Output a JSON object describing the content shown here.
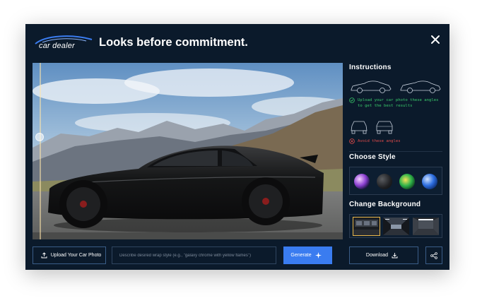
{
  "brand": {
    "name": "car dealer",
    "colors": {
      "modal_bg": "#0b1a2b",
      "accent": "#3a7cf0",
      "ok": "#39c96b",
      "bad": "#e14b4b",
      "selected": "#e8b64a"
    }
  },
  "header": {
    "headline": "Looks before commitment.",
    "close_icon": "close-icon"
  },
  "preview": {
    "subject": "black sports car photo",
    "compare_handle_icon": "drag-handle-icon"
  },
  "instructions": {
    "title": "Instructions",
    "good_note": "Upload your car photo these angles to get the best results",
    "bad_note": "Avoid these angles",
    "good_icon": "check-circle-icon",
    "bad_icon": "x-circle-icon"
  },
  "styles": {
    "title": "Choose Style",
    "options": [
      "galaxy-chrome",
      "matte-black",
      "green-flame",
      "blue-gloss"
    ]
  },
  "backgrounds": {
    "title": "Change Background",
    "options": [
      "showroom-dark",
      "tunnel-lights",
      "studio-garage"
    ]
  },
  "toolbar": {
    "upload_label": "Upload Your Car Photo",
    "prompt_placeholder": "Describe desired wrap style (e.g., \"galaxy chrome with yellow flames\")",
    "generate_label": "Generate",
    "download_label": "Download",
    "upload_icon": "upload-icon",
    "generate_icon": "sparkle-icon",
    "download_icon": "download-icon",
    "share_icon": "share-icon"
  }
}
